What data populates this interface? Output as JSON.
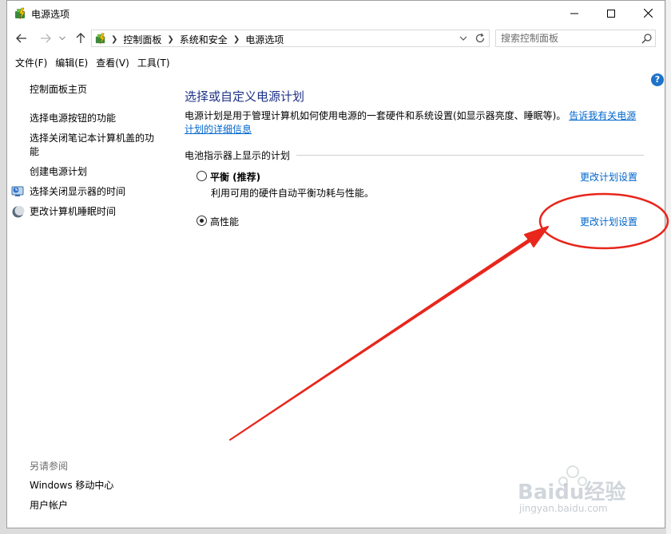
{
  "window": {
    "title": "电源选项"
  },
  "address_bar": {
    "breadcrumbs": [
      "控制面板",
      "系统和安全",
      "电源选项"
    ]
  },
  "search": {
    "placeholder": "搜索控制面板"
  },
  "menu": {
    "items": [
      "文件(F)",
      "编辑(E)",
      "查看(V)",
      "工具(T)"
    ]
  },
  "sidebar": {
    "home": "控制面板主页",
    "links": [
      "选择电源按钮的功能",
      "选择关闭笔记本计算机盖的功能",
      "创建电源计划",
      "选择关闭显示器的时间",
      "更改计算机睡眠时间"
    ],
    "see_also_title": "另请参阅",
    "see_also": [
      "Windows 移动中心",
      "用户帐户"
    ]
  },
  "main": {
    "heading": "选择或自定义电源计划",
    "description": "电源计划是用于管理计算机如何使用电源的一套硬件和系统设置(如显示器亮度、睡眠等)。",
    "learn_more": "告诉我有关电源计划的详细信息",
    "group_label": "电池指示器上显示的计划",
    "plans": [
      {
        "name": "平衡 (推荐)",
        "description": "利用可用的硬件自动平衡功耗与性能。",
        "selected": false,
        "change_link": "更改计划设置"
      },
      {
        "name": "高性能",
        "description": "",
        "selected": true,
        "change_link": "更改计划设置"
      }
    ]
  },
  "help": {
    "label": "?"
  },
  "watermark": {
    "text": "Baidu经验",
    "sub": "jingyan.baidu.com"
  },
  "colors": {
    "heading": "#1e3287",
    "link": "#0066cc",
    "annotation": "#e8261c"
  }
}
